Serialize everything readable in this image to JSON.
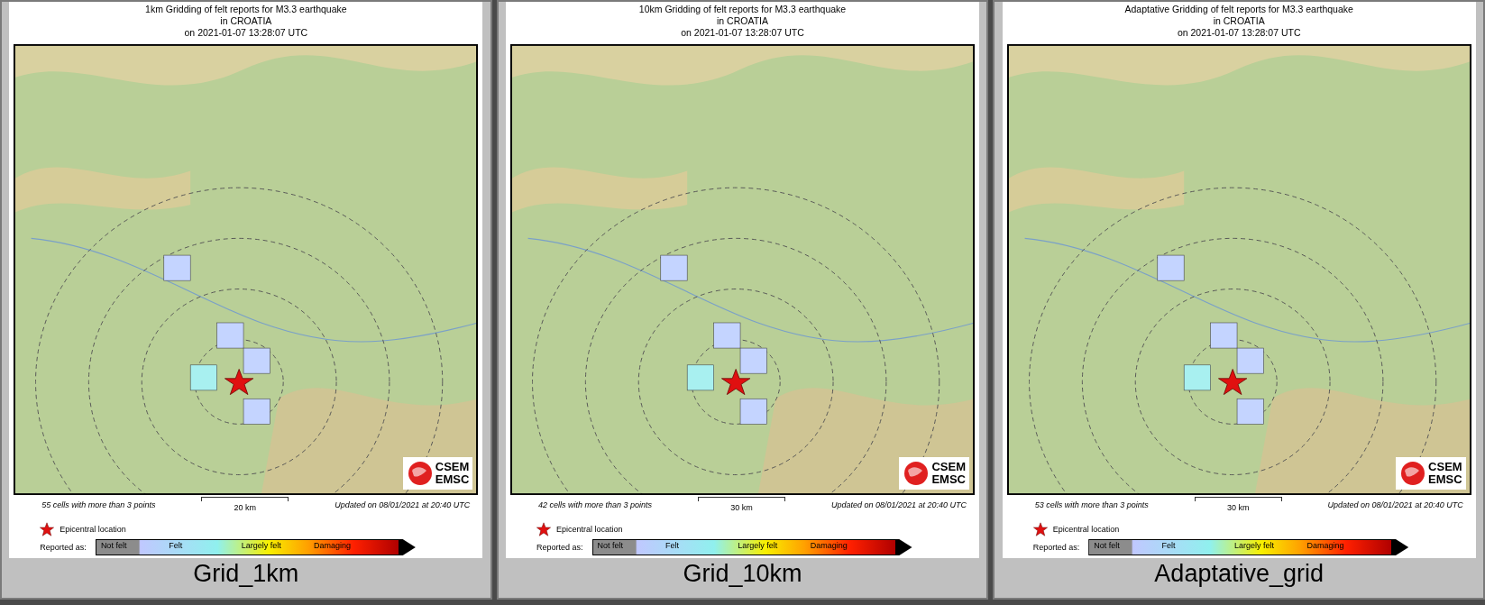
{
  "panels": [
    {
      "title_lines": [
        "1km Gridding of felt reports for M3.3 earthquake",
        "in CROATIA",
        "on  2021-01-07 13:28:07 UTC"
      ],
      "cells_note": "55 cells with more than 3 points",
      "scale": "20 km",
      "updated": "Updated on 08/01/2021 at 20:40 UTC",
      "logo": [
        "CSEM",
        "EMSC"
      ],
      "epicentre_label": "Epicentral location",
      "reported_label": "Reported as:",
      "scale_labels": [
        "Not felt",
        "Felt",
        "Largely felt",
        "Damaging"
      ],
      "caption": "Grid_1km"
    },
    {
      "title_lines": [
        "10km Gridding of felt reports for M3.3 earthquake",
        "in CROATIA",
        "on  2021-01-07 13:28:07 UTC"
      ],
      "cells_note": "42 cells with more than 3 points",
      "scale": "30 km",
      "updated": "Updated on 08/01/2021 at 20:40 UTC",
      "logo": [
        "CSEM",
        "EMSC"
      ],
      "epicentre_label": "Epicentral location",
      "reported_label": "Reported as:",
      "scale_labels": [
        "Not felt",
        "Felt",
        "Largely felt",
        "Damaging"
      ],
      "caption": "Grid_10km"
    },
    {
      "title_lines": [
        "Adaptative Gridding of felt reports for M3.3 earthquake",
        "in CROATIA",
        "on  2021-01-07 13:28:07 UTC"
      ],
      "cells_note": "53 cells with more than 3 points",
      "scale": "30 km",
      "updated": "Updated on 08/01/2021 at 20:40 UTC",
      "logo": [
        "CSEM",
        "EMSC"
      ],
      "epicentre_label": "Epicentral location",
      "reported_label": "Reported as:",
      "scale_labels": [
        "Not felt",
        "Felt",
        "Largely felt",
        "Damaging"
      ],
      "caption": "Adaptative_grid"
    }
  ]
}
